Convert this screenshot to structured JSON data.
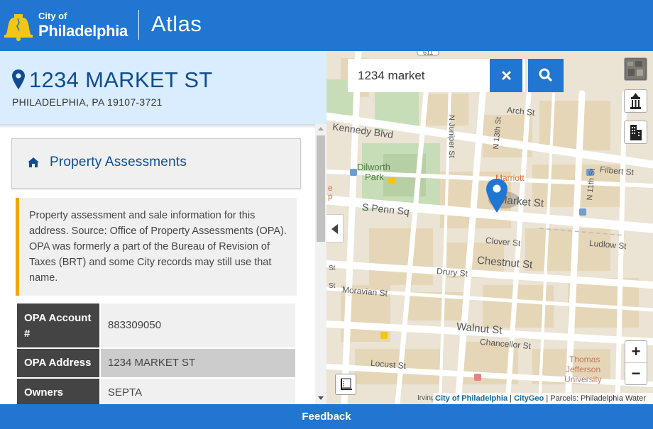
{
  "header": {
    "logo_city": "City of",
    "logo_name": "Philadelphia",
    "app_title": "Atlas"
  },
  "address": {
    "street": "1234 MARKET ST",
    "city_line": "PHILADELPHIA, PA 19107-3721"
  },
  "topic": {
    "title": "Property Assessments",
    "icon": "home-icon"
  },
  "callout": {
    "text": "Property assessment and sale information for this address. Source: Office of Property Assessments (OPA). OPA was formerly a part of the Bureau of Revision of Taxes (BRT) and some City records may still use that name."
  },
  "table": {
    "rows": [
      {
        "label": "OPA Account #",
        "value": "883309050"
      },
      {
        "label": "OPA Address",
        "value": "1234 MARKET ST"
      },
      {
        "label": "Owners",
        "value": "SEPTA"
      }
    ]
  },
  "search": {
    "value": "1234 market",
    "clear_icon": "times-icon",
    "search_icon": "search-icon"
  },
  "map": {
    "labels": {
      "kennedy": "Kennedy Blvd",
      "arch": "Arch St",
      "juniper": "N Juniper St",
      "dilworth1": "Dilworth",
      "dilworth2": "Park",
      "n13th": "N 13th St",
      "marriott": "Marriott",
      "filbert": "Filbert St",
      "n11th": "N 11th St",
      "market": "Market St",
      "spenn": "S Penn Sq",
      "clover": "Clover St",
      "ludlow": "Ludlow St",
      "drury": "Drury St",
      "chestnut": "Chestnut St",
      "moravian": "Moravian St",
      "walnut": "Walnut St",
      "chancellor": "Chancellor St",
      "locust": "Locust St",
      "thomas1": "Thomas",
      "thomas2": "Jefferson",
      "thomas3": "University",
      "irving": "Irving St",
      "route": "611",
      "st_left1": "St",
      "st_left2": "St",
      "e_left": "e",
      "p_left": "p"
    },
    "zoom_in": "+",
    "zoom_out": "−",
    "attribution": {
      "link1": "City of Philadelphia",
      "sep": "|",
      "link2": "CityGeo",
      "rest": "| Parcels: Philadelphia Water"
    }
  },
  "footer": {
    "label": "Feedback"
  },
  "colors": {
    "brand_blue": "#2176d2",
    "address_bg": "#daedfe",
    "callout_accent": "#f3a600",
    "marker": "#2176d2"
  }
}
